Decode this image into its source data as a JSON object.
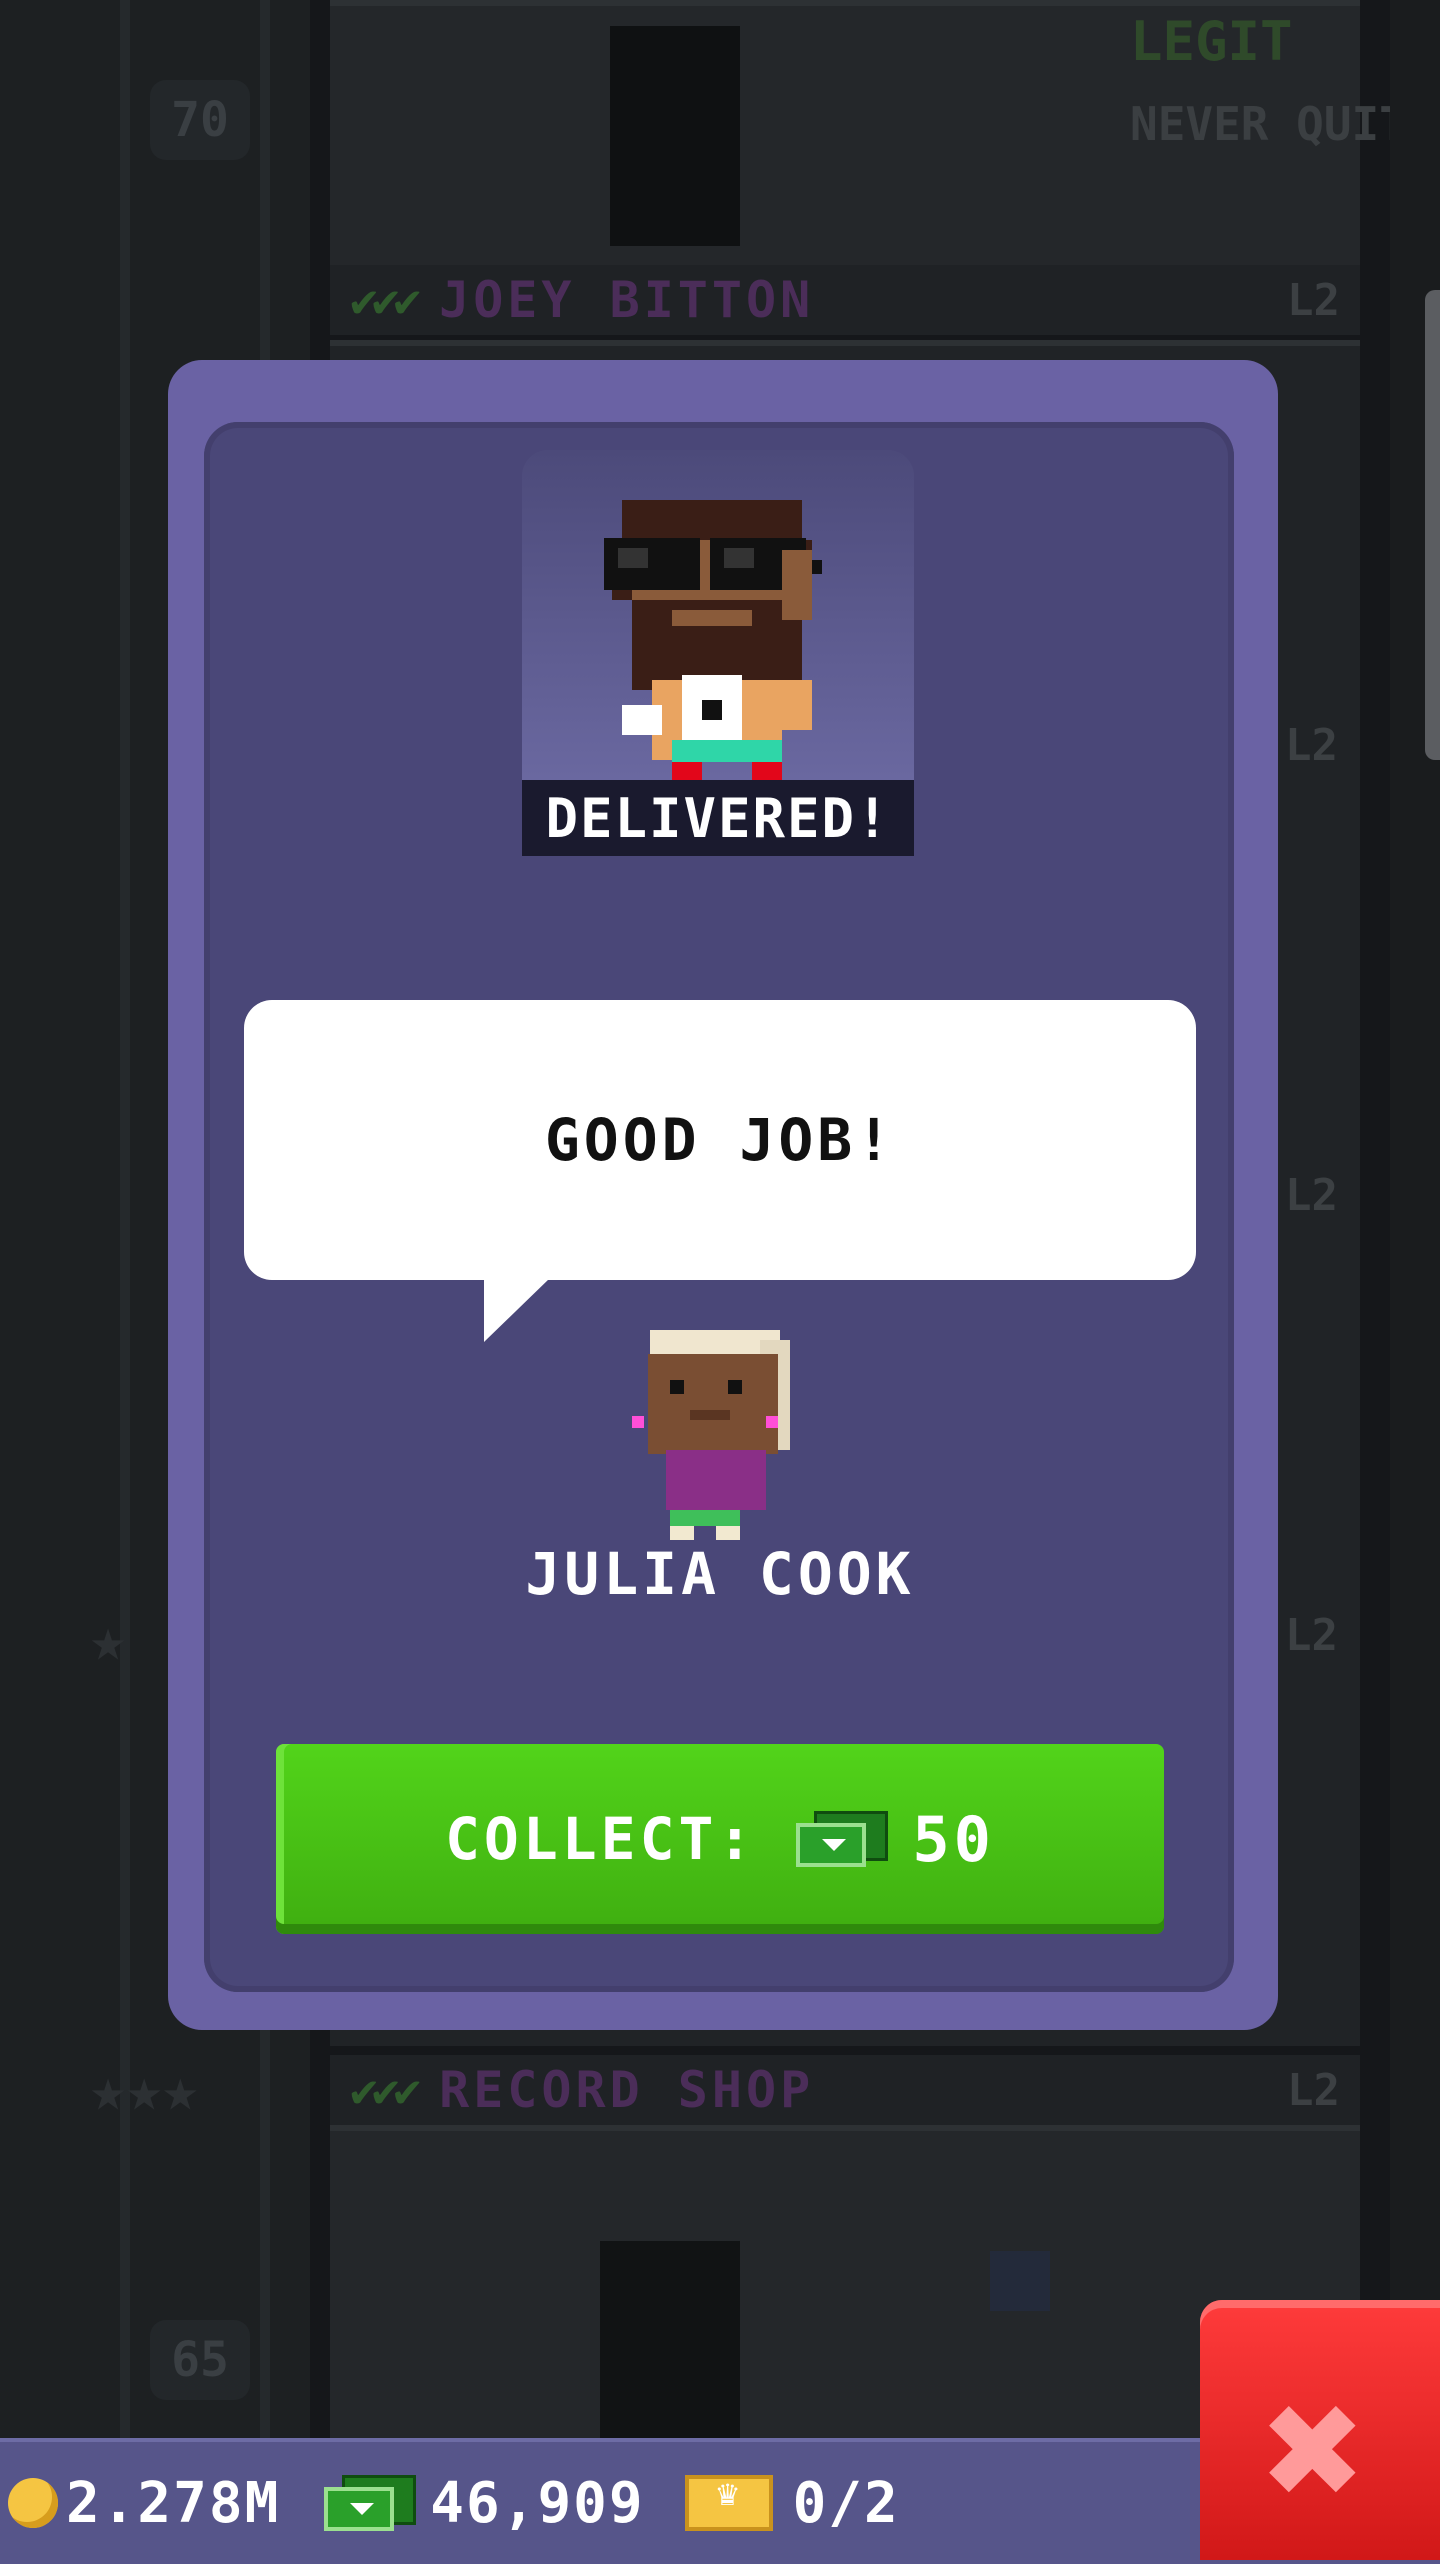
{
  "background": {
    "floors": [
      {
        "number": "70",
        "name": "JOEY BITTON",
        "level": "L2"
      },
      {
        "number": "65",
        "name": "RECORD SHOP",
        "level": "L2"
      }
    ],
    "side_levels": [
      "L2",
      "L2",
      "L2"
    ],
    "sign_legit": "LEGIT",
    "sign_never_quits": "NEVER QUITS"
  },
  "modal": {
    "status_label": "DELIVERED!",
    "speech": "GOOD JOB!",
    "recipient_name": "JULIA COOK",
    "collect_label": "COLLECT:",
    "collect_amount": "50",
    "reward_icon": "tower-bux-icon"
  },
  "hud": {
    "coins": "2.278M",
    "bux": "46,909",
    "vip": "0/2",
    "icons": [
      "coin-icon",
      "tower-bux-icon",
      "vip-ticket-icon"
    ]
  },
  "colors": {
    "modal_frame": "#6a62a4",
    "modal_body": "#4a4778",
    "collect_button": "#4ac21a",
    "close_button": "#e52222",
    "hud_bar": "#56558a"
  }
}
